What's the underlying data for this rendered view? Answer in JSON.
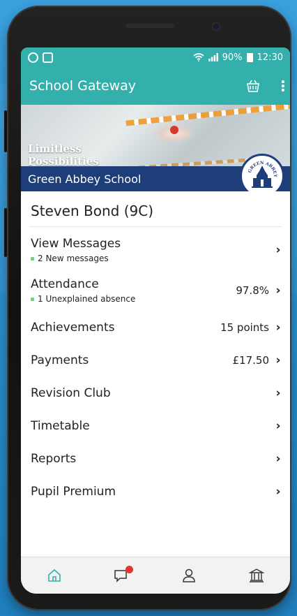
{
  "status_bar": {
    "battery": "90%",
    "time": "12:30"
  },
  "app_bar": {
    "title": "School Gateway"
  },
  "banner": {
    "tagline_line1": "Limitless",
    "tagline_line2": "Possibilities",
    "school_name": "Green Abbey School",
    "crest_text": "GREEN ABBEY"
  },
  "student": {
    "name": "Steven Bond (9C)"
  },
  "menu": {
    "items": [
      {
        "label": "View Messages",
        "sub": "2 New messages",
        "value": ""
      },
      {
        "label": "Attendance",
        "sub": "1 Unexplained absence",
        "value": "97.8%"
      },
      {
        "label": "Achievements",
        "sub": "",
        "value": "15 points"
      },
      {
        "label": "Payments",
        "sub": "",
        "value": "£17.50"
      },
      {
        "label": "Revision Club",
        "sub": "",
        "value": ""
      },
      {
        "label": "Timetable",
        "sub": "",
        "value": ""
      },
      {
        "label": "Reports",
        "sub": "",
        "value": ""
      },
      {
        "label": "Pupil Premium",
        "sub": "",
        "value": ""
      }
    ]
  },
  "bottom_nav": {
    "items": [
      "home-icon",
      "messages-icon",
      "profile-icon",
      "school-icon"
    ]
  },
  "colors": {
    "teal": "#33b0ab",
    "navy": "#1e3e7a",
    "page_blue": "#2a8fcf",
    "badge_red": "#e2362f",
    "sub_dot_green": "#7fc98a"
  }
}
